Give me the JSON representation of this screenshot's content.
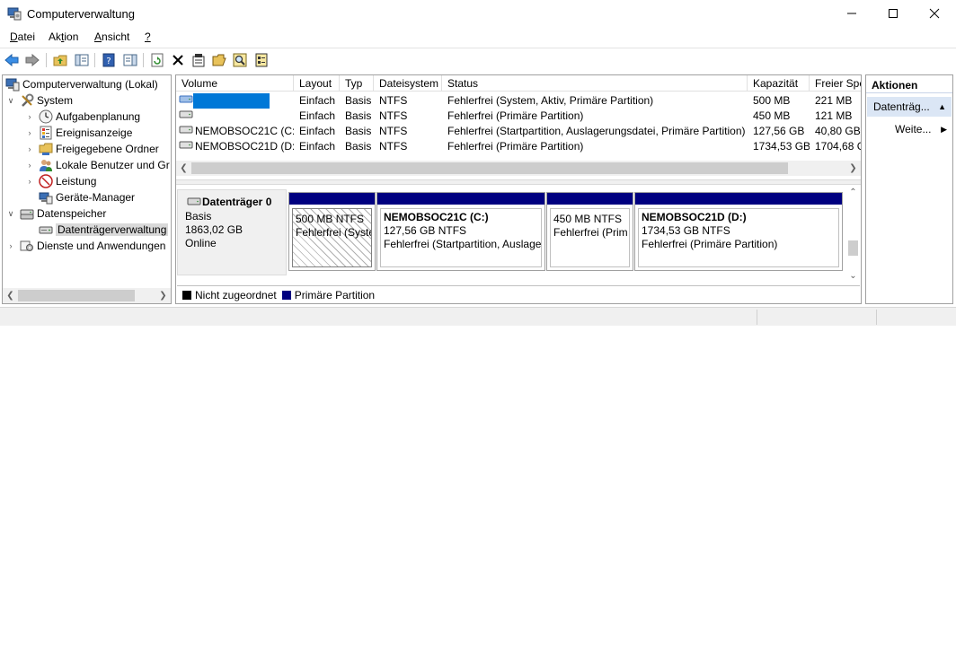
{
  "window": {
    "title": "Computerverwaltung",
    "minimize": "—",
    "maximize": "☐",
    "close": "✕"
  },
  "menu": {
    "datei": {
      "pre": "",
      "u": "D",
      "post": "atei"
    },
    "aktion": {
      "pre": "Ak",
      "u": "t",
      "post": "ion"
    },
    "ansicht": {
      "pre": "",
      "u": "A",
      "post": "nsicht"
    },
    "help": {
      "pre": "",
      "u": "?",
      "post": ""
    }
  },
  "tree": {
    "root": "Computerverwaltung (Lokal)",
    "system": "System",
    "aufgabenplanung": "Aufgabenplanung",
    "ereignisanzeige": "Ereignisanzeige",
    "freigegebene": "Freigegebene Ordner",
    "benutzer": "Lokale Benutzer und Gr",
    "leistung": "Leistung",
    "geraete": "Geräte-Manager",
    "datenspeicher": "Datenspeicher",
    "datentraeger": "Datenträgerverwaltung",
    "dienste": "Dienste und Anwendungen"
  },
  "volumes": {
    "columns": {
      "volume": "Volume",
      "layout": "Layout",
      "typ": "Typ",
      "dateisystem": "Dateisystem",
      "status": "Status",
      "kapazitaet": "Kapazität",
      "frei": "Freier Spe"
    },
    "rows": [
      {
        "volume": "",
        "layout": "Einfach",
        "typ": "Basis",
        "fs": "NTFS",
        "status": "Fehlerfrei (System, Aktiv, Primäre Partition)",
        "cap": "500 MB",
        "free": "221 MB"
      },
      {
        "volume": "",
        "layout": "Einfach",
        "typ": "Basis",
        "fs": "NTFS",
        "status": "Fehlerfrei (Primäre Partition)",
        "cap": "450 MB",
        "free": "121 MB"
      },
      {
        "volume": "NEMOBSOC21C (C:)",
        "layout": "Einfach",
        "typ": "Basis",
        "fs": "NTFS",
        "status": "Fehlerfrei (Startpartition, Auslagerungsdatei, Primäre Partition)",
        "cap": "127,56 GB",
        "free": "40,80 GB"
      },
      {
        "volume": "NEMOBSOC21D (D:)",
        "layout": "Einfach",
        "typ": "Basis",
        "fs": "NTFS",
        "status": "Fehlerfrei (Primäre Partition)",
        "cap": "1734,53 GB",
        "free": "1704,68 G"
      }
    ]
  },
  "disk": {
    "name": "Datenträger 0",
    "type": "Basis",
    "size": "1863,02 GB",
    "state": "Online",
    "partitions": [
      {
        "title": "",
        "size": "500 MB NTFS",
        "status": "Fehlerfrei (Syste"
      },
      {
        "title": "NEMOBSOC21C  (C:)",
        "size": "127,56 GB NTFS",
        "status": "Fehlerfrei (Startpartition, Auslage"
      },
      {
        "title": "",
        "size": "450 MB NTFS",
        "status": "Fehlerfrei (Prim"
      },
      {
        "title": "NEMOBSOC21D  (D:)",
        "size": "1734,53 GB NTFS",
        "status": "Fehlerfrei (Primäre Partition)"
      }
    ]
  },
  "legend": {
    "unallocated": "Nicht zugeordnet",
    "primary": "Primäre Partition"
  },
  "actions": {
    "title": "Aktionen",
    "item": "Datenträg...",
    "more": "Weite..."
  },
  "colors": {
    "primary_partition": "#000080",
    "unallocated": "#000000",
    "selection": "#0078d7"
  }
}
